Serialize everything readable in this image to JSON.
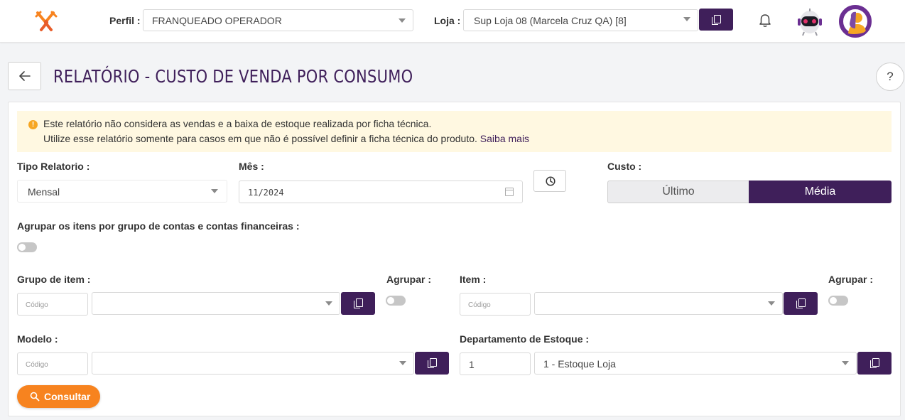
{
  "topbar": {
    "perfil_label": "Perfil :",
    "perfil_value": "FRANQUEADO OPERADOR",
    "loja_label": "Loja :",
    "loja_value": "Sup Loja 08 (Marcela Cruz QA) [8]"
  },
  "page": {
    "title": "RELATÓRIO - CUSTO DE VENDA POR CONSUMO",
    "help": "?"
  },
  "alert": {
    "line1": "Este relatório não considera as vendas e a baixa de estoque realizada por ficha técnica.",
    "line2": "Utilize esse relatório somente para casos em que não é possível definir a ficha técnica do produto.",
    "link": "Saiba mais",
    "icon": "!"
  },
  "form": {
    "tipo_label": "Tipo Relatorio :",
    "tipo_value": "Mensal",
    "mes_label": "Mês :",
    "mes_value": "11/2024",
    "custo_label": "Custo :",
    "custo_options": [
      "Último",
      "Média"
    ],
    "custo_selected": "Média",
    "agrupar_contas_label": "Agrupar os itens por grupo de contas e contas financeiras :",
    "grupo_item_label": "Grupo de item :",
    "grupo_item_code_placeholder": "Código",
    "agrupar_label": "Agrupar :",
    "item_label": "Item :",
    "item_code_placeholder": "Código",
    "agrupar2_label": "Agrupar :",
    "modelo_label": "Modelo :",
    "modelo_code_placeholder": "Código",
    "departamento_label": "Departamento de Estoque :",
    "departamento_code": "1",
    "departamento_value": "1 - Estoque Loja",
    "consultar_label": "Consultar"
  },
  "colors": {
    "primary": "#3f1f5a",
    "accent": "#f7831f",
    "alert_bg": "#fff8e1"
  }
}
